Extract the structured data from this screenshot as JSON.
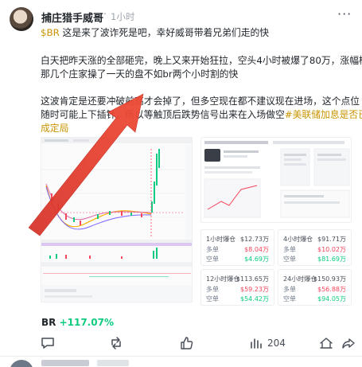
{
  "post": {
    "author": "捕庄猎手威哥",
    "time_sep": "·",
    "time": "1小时",
    "more_label": "···",
    "line1": {
      "cashtag": "$BR",
      "text": " 这是来了波诈死是吧，幸好威哥带着兄弟们走的快"
    },
    "para2": [
      "白天把昨天涨的全部砸完，晚上又来开始狂拉，空头4小时被爆了80万，涨幅榜",
      "那几个庄家操了一天的盘不如br两个小时割的快"
    ],
    "para3": {
      "line1": "这波肯定是还要冲破前高才会掉了，但多空现在都不建议现在进场，这个点位",
      "line2a": "随时可能上下插针，",
      "line2b": "所以等触顶后跌势信号出来在入场做空",
      "line2c": "#美联储加息是否已",
      "line3": "成定局"
    }
  },
  "stats_panels": [
    {
      "title": "1小时爆仓",
      "total": "$12.73万",
      "rows": [
        {
          "label": "多单",
          "value": "$8.04万",
          "color": "r"
        },
        {
          "label": "空单",
          "value": "$4.69万",
          "color": "g"
        }
      ]
    },
    {
      "title": "4小时爆仓",
      "total": "$91.71万",
      "rows": [
        {
          "label": "多单",
          "value": "$10.02万",
          "color": "r"
        },
        {
          "label": "空单",
          "value": "$81.69万",
          "color": "g"
        }
      ]
    },
    {
      "title": "12小时爆仓",
      "total": "$113.65万",
      "rows": [
        {
          "label": "多单",
          "value": "$59.23万",
          "color": "r"
        },
        {
          "label": "空单",
          "value": "$54.42万",
          "color": "g"
        }
      ]
    },
    {
      "title": "24小时爆仓",
      "total": "$150.93万",
      "rows": [
        {
          "label": "多单",
          "value": "$56.88万",
          "color": "r"
        },
        {
          "label": "空单",
          "value": "$94.05万",
          "color": "g"
        }
      ]
    }
  ],
  "ticker": {
    "symbol": "BR",
    "change": "+117.07%"
  },
  "actions": {
    "comment_count": "",
    "repost_count": "",
    "like_count": "",
    "views_count": "204"
  },
  "colors": {
    "up": "#0ecb81",
    "down": "#f6465d",
    "accent": "#c99400",
    "arrow": "#e03a2f"
  }
}
